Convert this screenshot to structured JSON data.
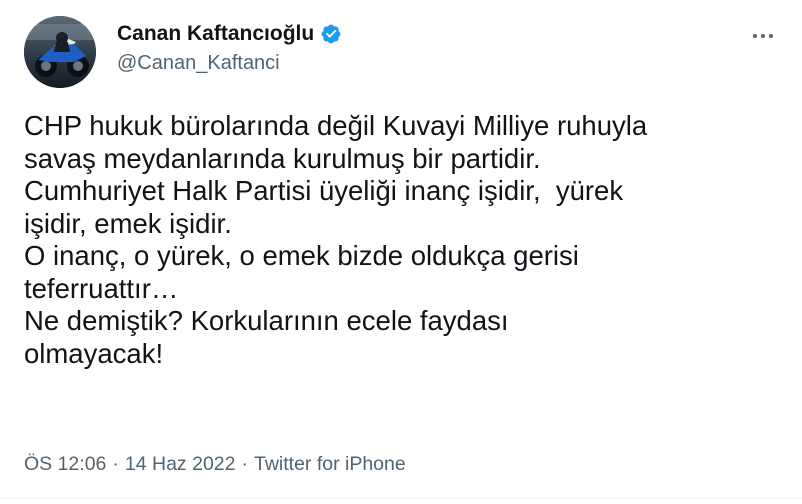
{
  "author": {
    "display_name": "Canan Kaftancıoğlu",
    "handle": "@Canan_Kaftanci",
    "verified": true,
    "verified_color": "#1d9bf0"
  },
  "tweet": {
    "lines": [
      "CHP hukuk bürolarında değil Kuvayi Milliye ruhuyla",
      "savaş meydanlarında kurulmuş bir partidir.",
      "Cumhuriyet Halk Partisi üyeliği inanç işidir,  yürek",
      "işidir, emek işidir.",
      "O inanç, o yürek, o emek bizde oldukça gerisi",
      "teferruattır…",
      "Ne demiştik? Korkularının ecele faydası",
      "olmayacak!"
    ]
  },
  "meta": {
    "time": "ÖS 12:06",
    "separator": "·",
    "date": "14 Haz 2022",
    "source": "Twitter for iPhone"
  },
  "icons": {
    "more": "more-horizontal-icon",
    "verified": "verified-badge-icon"
  }
}
